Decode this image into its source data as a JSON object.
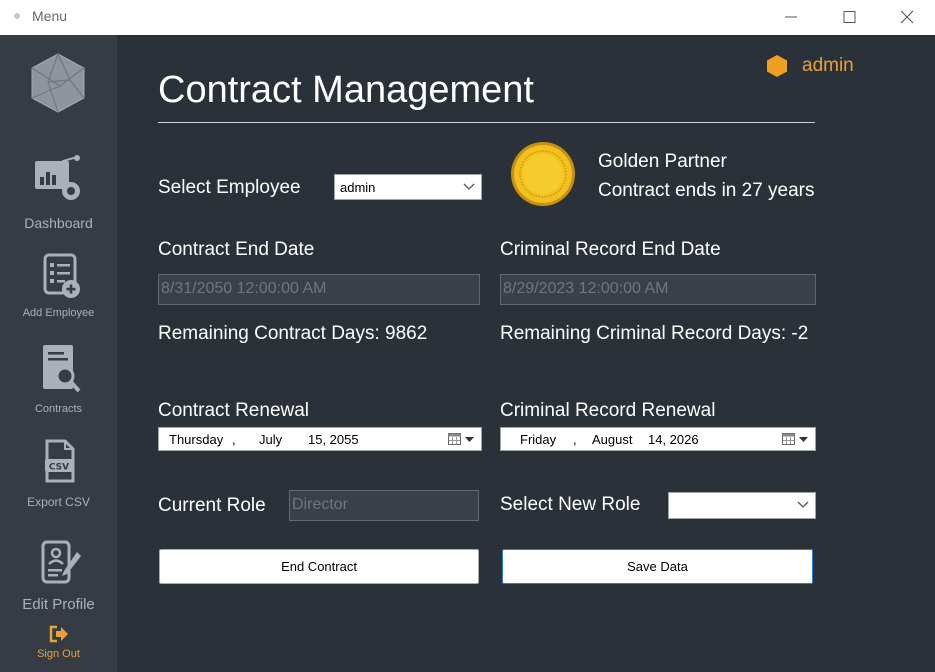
{
  "window": {
    "title": "Menu"
  },
  "sidebar": {
    "items": [
      {
        "label": "Dashboard"
      },
      {
        "label": "Add Employee"
      },
      {
        "label": "Contracts"
      },
      {
        "label": "Export CSV"
      },
      {
        "label": "Edit Profile"
      },
      {
        "label": "Sign Out"
      }
    ]
  },
  "header": {
    "user": "admin",
    "title": "Contract Management"
  },
  "employee": {
    "label": "Select Employee",
    "selected": "admin"
  },
  "partner": {
    "tier": "Golden Partner",
    "contract_note": "Contract ends in 27 years"
  },
  "contract": {
    "end_date_label": "Contract End Date",
    "end_date_value": "8/31/2050 12:00:00 AM",
    "remaining": "Remaining Contract Days: 9862",
    "renewal_label": "Contract Renewal",
    "renewal_date": {
      "weekday": "Thursday",
      "sep": ",",
      "month": "July",
      "daynum": "15, 2055"
    }
  },
  "criminal": {
    "end_date_label": "Criminal Record End Date",
    "end_date_value": "8/29/2023 12:00:00 AM",
    "remaining": "Remaining Criminal Record Days: -2",
    "renewal_label": "Criminal Record Renewal",
    "renewal_date": {
      "weekday": "Friday",
      "sep": ",",
      "month": "August",
      "daynum": "14, 2026"
    }
  },
  "role": {
    "current_label": "Current Role",
    "current_value": "Director",
    "new_label": "Select New Role",
    "new_value": ""
  },
  "actions": {
    "end_contract": "End Contract",
    "save": "Save Data"
  },
  "colors": {
    "sidebar": "#353c44",
    "main": "#2b3138",
    "accent": "#e8a23a",
    "coin": "#e7b51c",
    "primary_border": "#2f7fd0"
  }
}
